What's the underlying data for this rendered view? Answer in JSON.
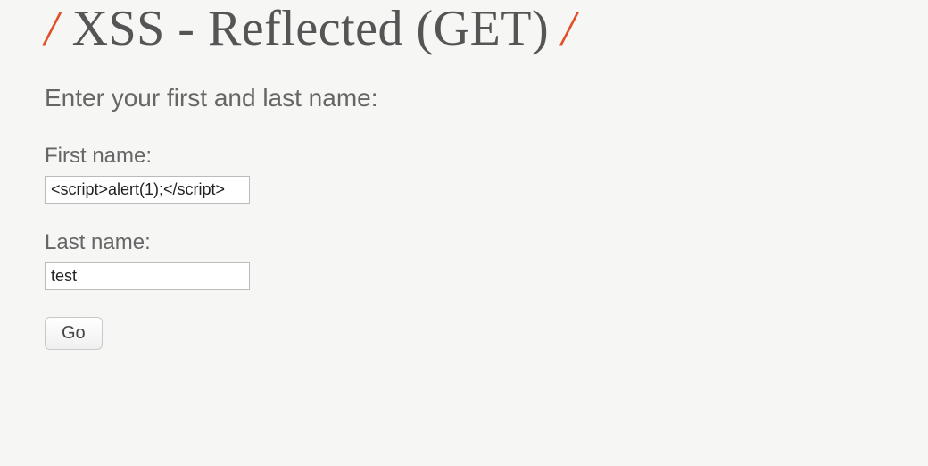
{
  "header": {
    "slash": "/",
    "title": "XSS - Reflected (GET)"
  },
  "form": {
    "prompt": "Enter your first and last name:",
    "first_name": {
      "label": "First name:",
      "value": "<script>alert(1);</script>"
    },
    "last_name": {
      "label": "Last name:",
      "value": "test"
    },
    "submit_label": "Go"
  }
}
